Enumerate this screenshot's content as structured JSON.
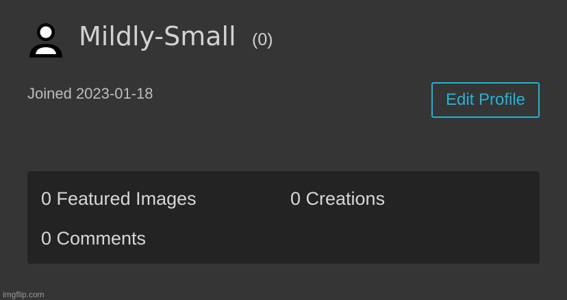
{
  "profile": {
    "username": "Mildly-Small",
    "points": "(0)",
    "joined": "Joined 2023-01-18",
    "avatar_icon": "user-silhouette-icon",
    "edit_button_label": "Edit Profile"
  },
  "stats": {
    "featured_images": "0 Featured Images",
    "creations": "0 Creations",
    "comments": "0 Comments"
  },
  "watermark": "imgflip.com",
  "colors": {
    "background": "#353535",
    "panel": "#232323",
    "accent": "#22b3d6",
    "text": "#d2d2d2"
  }
}
